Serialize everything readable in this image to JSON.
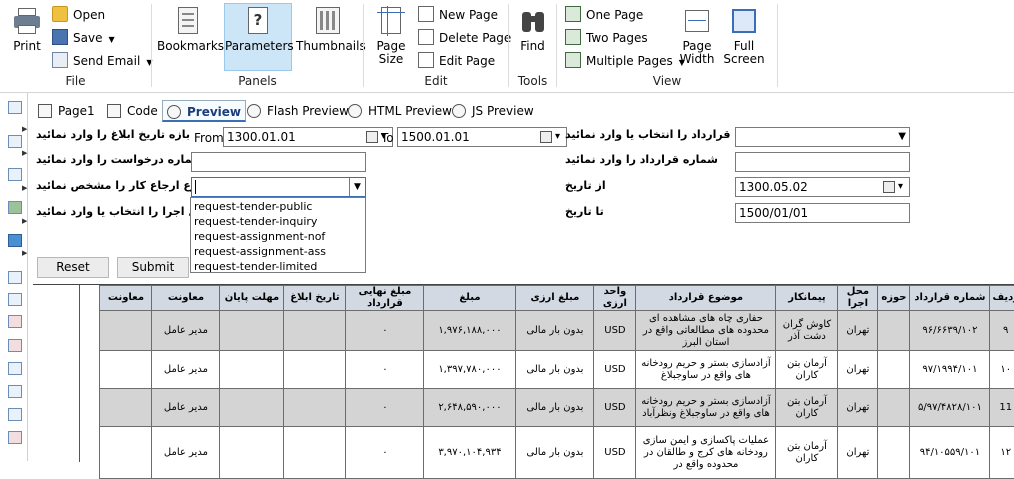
{
  "ribbon": {
    "file": {
      "label": "File",
      "print": "Print",
      "open": "Open",
      "save": "Save",
      "send_email": "Send Email"
    },
    "panels": {
      "label": "Panels",
      "bookmarks": "Bookmarks",
      "parameters": "Parameters",
      "thumbnails": "Thumbnails"
    },
    "edit": {
      "label": "Edit",
      "page_size": "Page\nSize",
      "new_page": "New Page",
      "delete_page": "Delete Page",
      "edit_page": "Edit Page"
    },
    "tools": {
      "label": "Tools",
      "find": "Find"
    },
    "view": {
      "label": "View",
      "one_page": "One Page",
      "two_pages": "Two Pages",
      "multiple_pages": "Multiple Pages",
      "page_width": "Page\nWidth",
      "full_screen": "Full\nScreen"
    }
  },
  "tabs": [
    "Page1",
    "Code",
    "Preview",
    "Flash Preview",
    "HTML Preview",
    "JS Preview"
  ],
  "form": {
    "left": {
      "date_range_label": "بازه تاریخ ابلاغ را وارد نمائید",
      "from_label": "From",
      "from_value": "1300.01.01",
      "to_label": "To",
      "to_value": "1500.01.01",
      "request_number_label": "شماره درخواست را وارد نمائید",
      "request_number_value": "",
      "referral_type_label": "نوع ارجاع کار را مشخص نمائید",
      "referral_type_value": "",
      "location_label": "محل اجرا را انتخاب یا وارد نمائید"
    },
    "dropdown_options": [
      "request-tender-public",
      "request-tender-inquiry",
      "request-assignment-nof",
      "request-assignment-ass",
      "request-tender-limited"
    ],
    "right": {
      "party_label": "طرف قرارداد را انتخاب یا وارد نمائید",
      "party_value": "",
      "contract_number_label": "شماره قرارداد را وارد نمائید",
      "contract_number_value": "",
      "from_date_label": "از تاریخ",
      "from_date_value": "1300.05.02",
      "to_date_label": "تا تاریخ",
      "to_date_value": "1500/01/01"
    },
    "reset": "Reset",
    "submit": "Submit"
  },
  "table": {
    "headers": [
      "ردیف",
      "شماره قرارداد",
      "حوزه",
      "محل اجرا",
      "پیمانکار",
      "موضوع قرارداد",
      "واحد ارزی",
      "مبلغ ارزی",
      "مبلغ",
      "مبلغ نهایی قرارداد",
      "تاریخ ابلاغ",
      "مهلت پایان",
      "معاونت",
      "معاونت"
    ],
    "rows": [
      [
        "۹",
        "۹۶/۶۶۳۹/۱۰۲",
        "",
        "تهران",
        "کاوش گران دشت آذر",
        "حفاری چاه های مشاهده ای محدوده های مطالعاتی واقع در استان البرز",
        "USD",
        "بدون بار مالی",
        "۱,۹۷۶,۱۸۸,۰۰۰",
        "۰",
        "",
        "",
        "مدیر عامل",
        ""
      ],
      [
        "۱۰",
        "۹۷/۱۹۹۴/۱۰۱",
        "",
        "تهران",
        "آرمان بتن کاران",
        "آزادسازی بستر و حریم رودخانه های واقع در ساوجبلاغ",
        "USD",
        "بدون بار مالی",
        "۱,۳۹۷,۷۸۰,۰۰۰",
        "۰",
        "",
        "",
        "مدیر عامل",
        ""
      ],
      [
        "11",
        "۵/۹۷/۴۸۲۸/۱۰۱",
        "",
        "تهران",
        "آرمان بتن کاران",
        "آزادسازی بستر و حریم رودخانه های واقع در ساوجبلاغ ونظرآباد",
        "USD",
        "بدون بار مالی",
        "۲,۶۴۸,۵۹۰,۰۰۰",
        "۰",
        "",
        "",
        "مدیر عامل",
        ""
      ],
      [
        "۱۲",
        "۹۴/۱۰۵۵۹/۱۰۱",
        "",
        "تهران",
        "آرمان بتن کاران",
        "عملیات پاکسازی و ایمن سازی رودخانه های کرج و طالقان در محدوده واقع در",
        "USD",
        "بدون بار مالی",
        "۳,۹۷۰,۱۰۴,۹۳۴",
        "۰",
        "",
        "",
        "مدیر عامل",
        ""
      ]
    ]
  },
  "colors": {
    "accent": "#3a6fb5",
    "selected_button": "#cde6f7",
    "header_bg": "#d3d9e3",
    "row_gray": "#d4d4d4"
  }
}
